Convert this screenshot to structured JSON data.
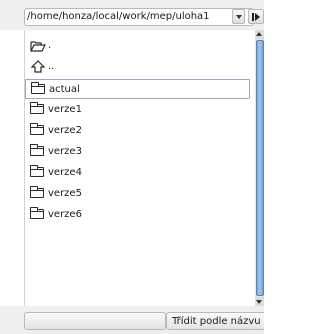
{
  "path_bar": {
    "path": "/home/honza/local/work/mep/uloha1"
  },
  "file_list": {
    "items": [
      {
        "name": ".",
        "icon": "open-folder-icon"
      },
      {
        "name": "..",
        "icon": "up-arrow-icon"
      },
      {
        "name": "actual",
        "icon": "folder-icon",
        "selected": true
      },
      {
        "name": "verze1",
        "icon": "folder-icon"
      },
      {
        "name": "verze2",
        "icon": "folder-icon"
      },
      {
        "name": "verze3",
        "icon": "folder-icon"
      },
      {
        "name": "verze4",
        "icon": "folder-icon"
      },
      {
        "name": "verze5",
        "icon": "folder-icon"
      },
      {
        "name": "verze6",
        "icon": "folder-icon"
      }
    ]
  },
  "bottom_bar": {
    "sort_label": "Třídit podle názvu"
  },
  "colors": {
    "scrollbar_thumb": "#8fb6e2",
    "selection_border": "#9aa9c2",
    "toolbar_bg": "#efefef"
  }
}
